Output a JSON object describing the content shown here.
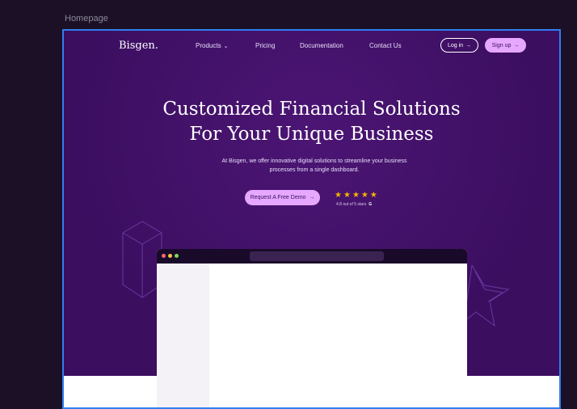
{
  "canvas": {
    "frame_label": "Homepage"
  },
  "brand": {
    "logo": "Bisgen."
  },
  "nav": {
    "items": [
      {
        "label": "Products",
        "has_dropdown": true
      },
      {
        "label": "Pricing"
      },
      {
        "label": "Documentation"
      },
      {
        "label": "Contact Us"
      }
    ],
    "login_label": "Log in",
    "signup_label": "Sign up"
  },
  "hero": {
    "headline_line1": "Customized Financial Solutions",
    "headline_line2": "For Your Unique Business",
    "subtext_line1": "At Bisgen, we offer innovative digital solutions to streamline your business",
    "subtext_line2": "processes from a single dashboard.",
    "cta_label": "Request A Free Demo",
    "rating": {
      "stars": 5,
      "text": "4.8 out of 5 stars",
      "source_icon": "google-icon"
    }
  },
  "colors": {
    "hero_bg": "#3b0e60",
    "accent": "#e6a8ff",
    "star": "#f5b400",
    "frame_selection": "#2f7ff0",
    "canvas_bg": "#1c1027"
  },
  "icons": {
    "arrow": "arrow-right-icon",
    "chevron": "chevron-down-icon"
  }
}
